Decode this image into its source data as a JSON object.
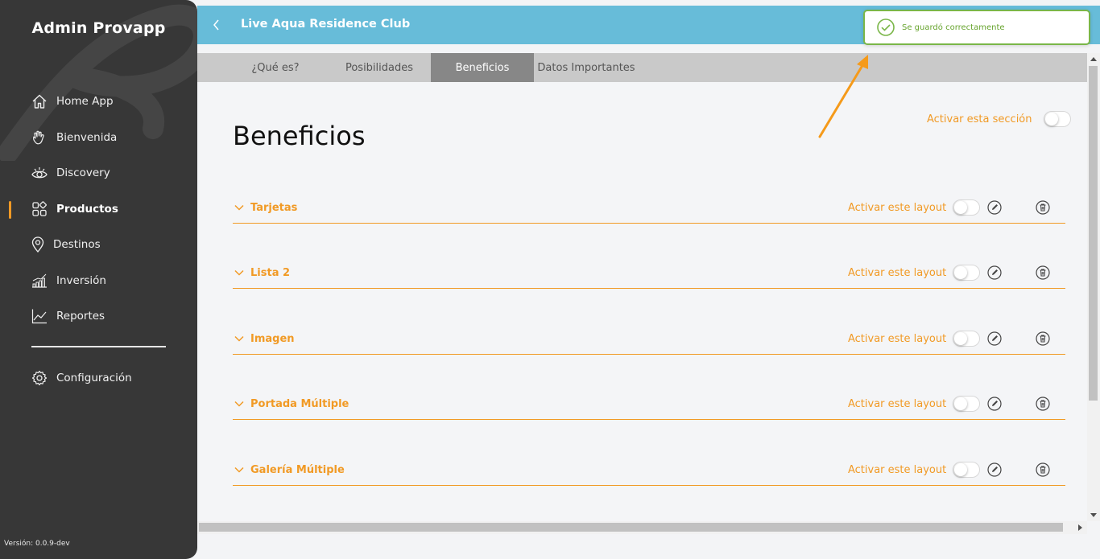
{
  "sidebar": {
    "brand": "Admin Provapp",
    "items": [
      {
        "label": "Home App",
        "icon": "home-icon"
      },
      {
        "label": "Bienvenida",
        "icon": "wave-hand-icon"
      },
      {
        "label": "Discovery",
        "icon": "eye-icon"
      },
      {
        "label": "Productos",
        "icon": "grid-icon",
        "active": true
      },
      {
        "label": "Destinos",
        "icon": "location-pin-icon"
      },
      {
        "label": "Inversión",
        "icon": "bar-chart-icon"
      },
      {
        "label": "Reportes",
        "icon": "line-chart-icon"
      }
    ],
    "config_label": "Configuración",
    "version": "Versión: 0.0.9-dev"
  },
  "header": {
    "title": "Live Aqua Residence Club"
  },
  "toast": {
    "message": "Se guardó correctamente"
  },
  "tabs": [
    {
      "label": "¿Qué es?"
    },
    {
      "label": "Posibilidades"
    },
    {
      "label": "Beneficios",
      "active": true
    },
    {
      "label": "Datos Importantes"
    }
  ],
  "main": {
    "heading": "Beneficios",
    "activate_section_label": "Activar esta sección",
    "layouts": [
      {
        "name": "Tarjetas",
        "activate_label": "Activar este layout"
      },
      {
        "name": "Lista 2",
        "activate_label": "Activar este layout"
      },
      {
        "name": "Imagen",
        "activate_label": "Activar este layout"
      },
      {
        "name": "Portada Múltiple",
        "activate_label": "Activar este layout"
      },
      {
        "name": "Galería Múltiple",
        "activate_label": "Activar este layout"
      }
    ]
  },
  "colors": {
    "sidebar_bg": "#373737",
    "header_bg": "#67bcd9",
    "accent_orange": "#f19a25",
    "toast_green": "#7ab648"
  }
}
